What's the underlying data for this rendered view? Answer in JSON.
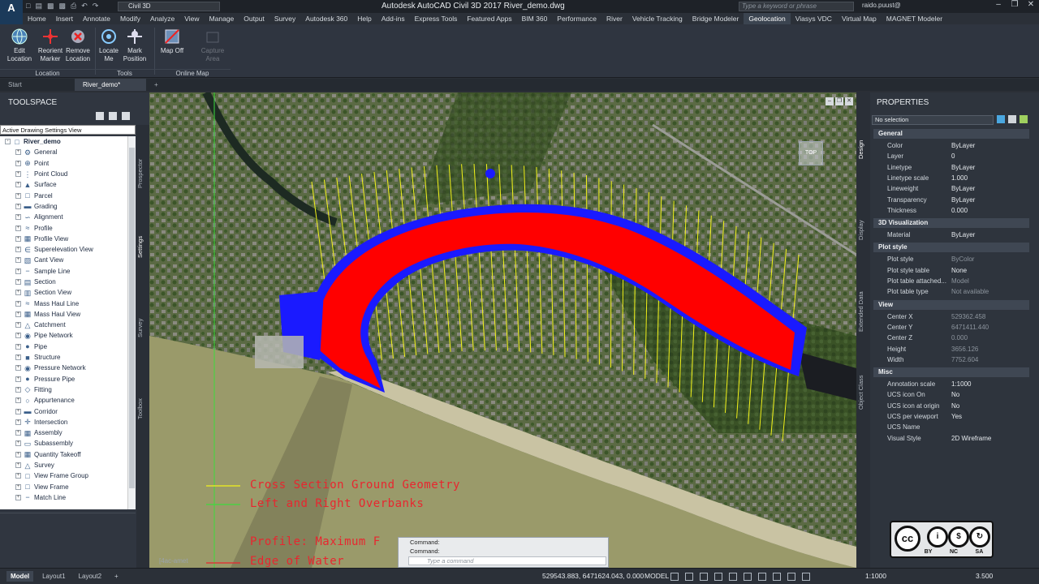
{
  "app": {
    "logo_text": "A",
    "workspace": "Civil 3D",
    "title": "Autodesk AutoCAD Civil 3D 2017   River_demo.dwg",
    "search_placeholder": "Type a keyword or phrase",
    "user": "raido.puust@"
  },
  "ribbon_tabs": [
    "Home",
    "Insert",
    "Annotate",
    "Modify",
    "Analyze",
    "View",
    "Manage",
    "Output",
    "Survey",
    "Autodesk 360",
    "Help",
    "Add-ins",
    "Express Tools",
    "Featured Apps",
    "BIM 360",
    "Performance",
    "River",
    "Vehicle Tracking",
    "Bridge Modeler",
    "Geolocation",
    "Viasys VDC",
    "Virtual Map",
    "MAGNET Modeler"
  ],
  "active_tab": "Geolocation",
  "ribbon": {
    "edit_location": "Edit Location",
    "reorient_marker": "Reorient Marker",
    "remove_location": "Remove Location",
    "locate_me": "Locate Me",
    "mark_position": "Mark Position",
    "map_off": "Map Off",
    "capture_area": "Capture Area",
    "panel_location": "Location",
    "panel_tools": "Tools",
    "panel_online_map": "Online Map"
  },
  "file_tabs": [
    "Start",
    "River_demo*"
  ],
  "toolspace": {
    "title": "TOOLSPACE",
    "view_selector": "Active Drawing Settings View",
    "root": "River_demo",
    "items": [
      "General",
      "Point",
      "Point Cloud",
      "Surface",
      "Parcel",
      "Grading",
      "Alignment",
      "Profile",
      "Profile View",
      "Superelevation View",
      "Cant View",
      "Sample Line",
      "Section",
      "Section View",
      "Mass Haul Line",
      "Mass Haul View",
      "Catchment",
      "Pipe Network",
      "Pipe",
      "Structure",
      "Pressure Network",
      "Pressure Pipe",
      "Fitting",
      "Appurtenance",
      "Corridor",
      "Intersection",
      "Assembly",
      "Subassembly",
      "Quantity Takeoff",
      "Survey",
      "View Frame Group",
      "View Frame",
      "Match Line"
    ],
    "vtabs": [
      "Prospector",
      "Settings",
      "Survey",
      "Toolbox"
    ]
  },
  "viewport": {
    "legend": [
      "Cross Section Ground Geometry",
      "Left and Right Overbanks",
      "Profile: Maximum F",
      "Edge of Water"
    ],
    "cmd_history": [
      "Command:",
      "Command:"
    ],
    "cmd_placeholder": "Type a command",
    "viewcube": "TOP",
    "corner_label": "[4ac-amet"
  },
  "properties": {
    "title": "PROPERTIES",
    "selection": "No selection",
    "vtabs": [
      "Design",
      "Display",
      "Extended Data",
      "Object Class"
    ],
    "sections": [
      {
        "name": "General",
        "rows": [
          [
            "Color",
            "ByLayer"
          ],
          [
            "Layer",
            "0"
          ],
          [
            "Linetype",
            "ByLayer"
          ],
          [
            "Linetype scale",
            "1.000"
          ],
          [
            "Lineweight",
            "ByLayer"
          ],
          [
            "Transparency",
            "ByLayer"
          ],
          [
            "Thickness",
            "0.000"
          ]
        ]
      },
      {
        "name": "3D Visualization",
        "rows": [
          [
            "Material",
            "ByLayer"
          ]
        ]
      },
      {
        "name": "Plot style",
        "rows": [
          [
            "Plot style",
            "ByColor"
          ],
          [
            "Plot style table",
            "None"
          ],
          [
            "Plot table attached...",
            "Model"
          ],
          [
            "Plot table type",
            "Not available"
          ]
        ]
      },
      {
        "name": "View",
        "rows": [
          [
            "Center X",
            "529362.458"
          ],
          [
            "Center Y",
            "6471411.440"
          ],
          [
            "Center Z",
            "0.000"
          ],
          [
            "Height",
            "3656.126"
          ],
          [
            "Width",
            "7752.604"
          ]
        ]
      },
      {
        "name": "Misc",
        "rows": [
          [
            "Annotation scale",
            "1:1000"
          ],
          [
            "UCS icon On",
            "No"
          ],
          [
            "UCS icon at origin",
            "No"
          ],
          [
            "UCS per viewport",
            "Yes"
          ],
          [
            "UCS Name",
            ""
          ],
          [
            "Visual Style",
            "2D Wireframe"
          ]
        ]
      }
    ],
    "cc_labels": [
      "BY",
      "NC",
      "SA"
    ],
    "cc_text": "cc"
  },
  "status": {
    "tabs": [
      "Model",
      "Layout1",
      "Layout2"
    ],
    "coords": "529543.883, 6471624.043, 0.000",
    "mode": "MODEL",
    "scale": "1:1000",
    "lineweight": "3.500"
  },
  "colors": {
    "flood": "#ff0000",
    "water_edge": "#1a1aff",
    "sections": "#f2f21a",
    "overbank": "#3cdc3c"
  }
}
